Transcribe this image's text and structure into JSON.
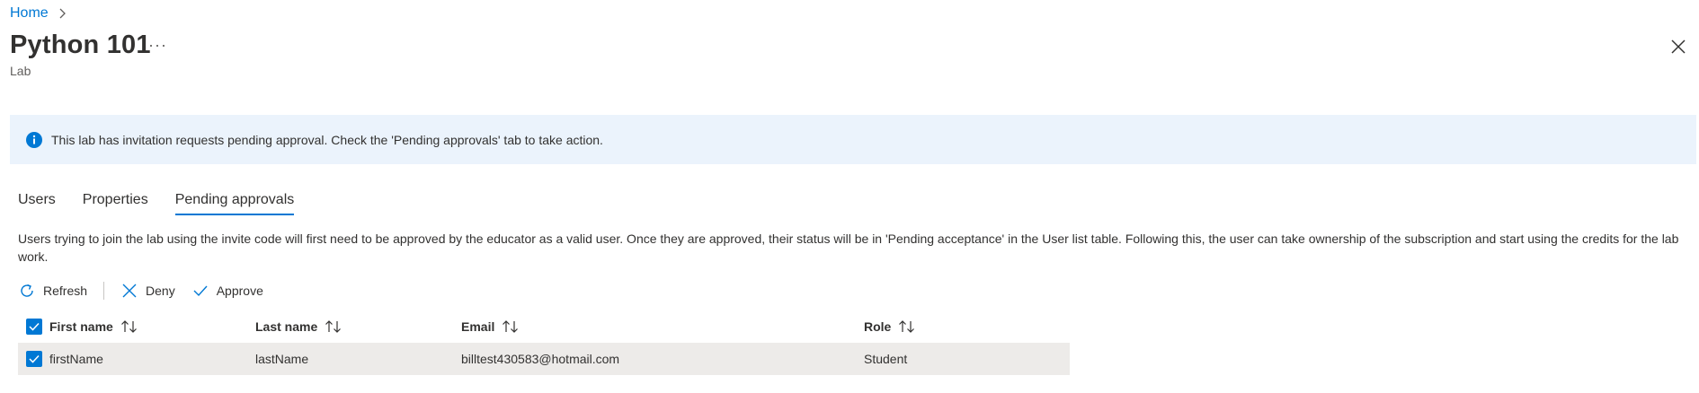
{
  "breadcrumb": {
    "home": "Home"
  },
  "header": {
    "title": "Python 101",
    "more": "···",
    "subtitle": "Lab"
  },
  "banner": {
    "icon": "info-icon",
    "text": "This lab has invitation requests pending approval. Check the 'Pending approvals' tab to take action."
  },
  "tabs": [
    {
      "label": "Users",
      "active": false
    },
    {
      "label": "Properties",
      "active": false
    },
    {
      "label": "Pending approvals",
      "active": true
    }
  ],
  "description": "Users trying to join the lab using the invite code will first need to be approved by the educator as a valid user. Once they are approved, their status will be in 'Pending acceptance' in the User list table. Following this, the user can take ownership of the subscription and start using the credits for the lab work.",
  "toolbar": {
    "refresh": "Refresh",
    "deny": "Deny",
    "approve": "Approve"
  },
  "table": {
    "columns": [
      "First name",
      "Last name",
      "Email",
      "Role"
    ],
    "rows": [
      {
        "first_name": "firstName",
        "last_name": "lastName",
        "email": "billtest430583@hotmail.com",
        "role": "Student",
        "selected": true
      }
    ]
  },
  "colors": {
    "accent": "#0078d4",
    "banner_bg": "#ebf3fc",
    "selected_row": "#edebe9"
  }
}
